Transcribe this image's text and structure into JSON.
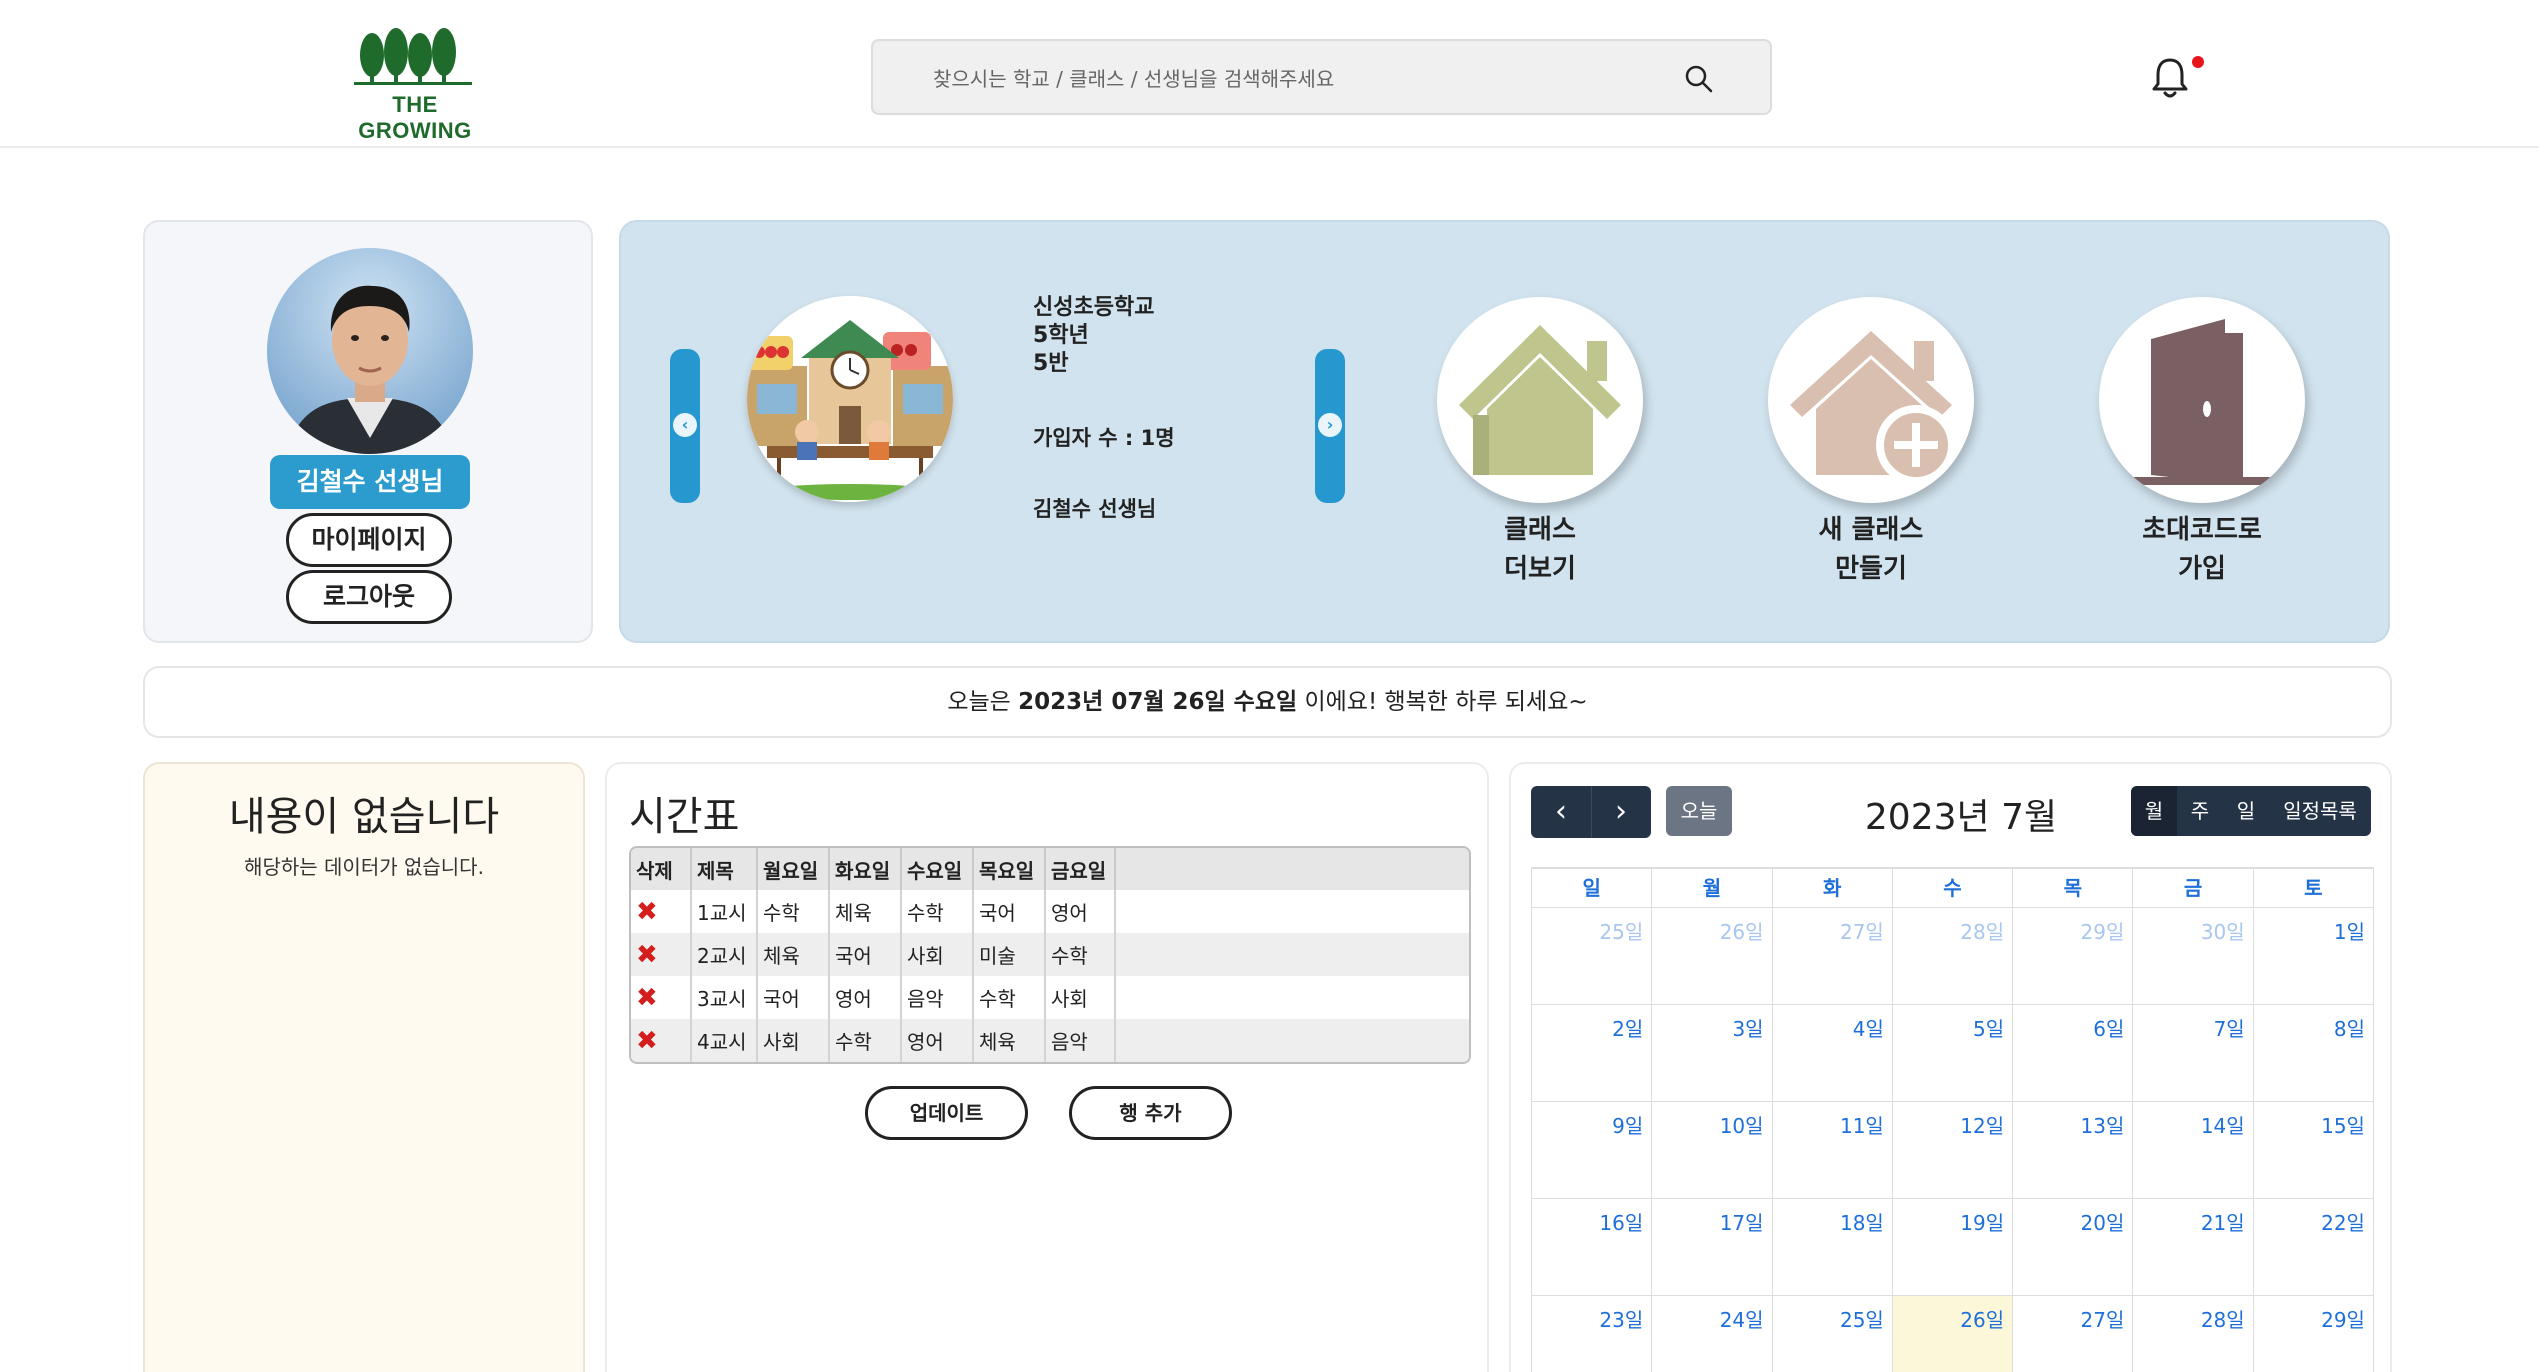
{
  "header": {
    "logo_text": "THE GROWING",
    "search_placeholder": "찾으시는 학교 / 클래스 / 선생님을 검색해주세요"
  },
  "profile": {
    "name": "김철수 선생님",
    "mypage_label": "마이페이지",
    "logout_label": "로그아웃"
  },
  "class_card": {
    "school": "신성초등학교",
    "grade": "5학년",
    "class": "5반",
    "members": "가입자 수 : 1명",
    "teacher": "김철수 선생님"
  },
  "actions": [
    {
      "line1": "클래스",
      "line2": "더보기",
      "icon": "house-icon"
    },
    {
      "line1": "새 클래스",
      "line2": "만들기",
      "icon": "house-plus-icon"
    },
    {
      "line1": "초대코드로",
      "line2": "가입",
      "icon": "door-icon"
    }
  ],
  "banner": {
    "prefix": "오늘은 ",
    "date": "2023년 07월 26일 수요일",
    "suffix": " 이에요! 행복한 하루 되세요~"
  },
  "empty": {
    "title": "내용이 없습니다",
    "subtitle": "해당하는 데이터가 없습니다."
  },
  "timetable": {
    "title": "시간표",
    "headers": [
      "삭제",
      "제목",
      "월요일",
      "화요일",
      "수요일",
      "목요일",
      "금요일"
    ],
    "rows": [
      [
        "1교시",
        "수학",
        "체육",
        "수학",
        "국어",
        "영어"
      ],
      [
        "2교시",
        "체육",
        "국어",
        "사회",
        "미술",
        "수학"
      ],
      [
        "3교시",
        "국어",
        "영어",
        "음악",
        "수학",
        "사회"
      ],
      [
        "4교시",
        "사회",
        "수학",
        "영어",
        "체육",
        "음악"
      ]
    ],
    "update_label": "업데이트",
    "add_row_label": "행 추가"
  },
  "calendar": {
    "prev": "‹",
    "next": "›",
    "today_label": "오늘",
    "title": "2023년 7월",
    "views": [
      "월",
      "주",
      "일",
      "일정목록"
    ],
    "active_view": "월",
    "weekdays": [
      "일",
      "월",
      "화",
      "수",
      "목",
      "금",
      "토"
    ],
    "weeks": [
      [
        "25일",
        "26일",
        "27일",
        "28일",
        "29일",
        "30일",
        "1일"
      ],
      [
        "2일",
        "3일",
        "4일",
        "5일",
        "6일",
        "7일",
        "8일"
      ],
      [
        "9일",
        "10일",
        "11일",
        "12일",
        "13일",
        "14일",
        "15일"
      ],
      [
        "16일",
        "17일",
        "18일",
        "19일",
        "20일",
        "21일",
        "22일"
      ],
      [
        "23일",
        "24일",
        "25일",
        "26일",
        "27일",
        "28일",
        "29일"
      ]
    ],
    "today": "26일"
  },
  "colors": {
    "accent_blue": "#2c9ccf",
    "panel_blue": "#d1e3ee",
    "calendar_dark": "#253347",
    "date_blue": "#1e6fd9",
    "delete_red": "#d41d1d"
  }
}
